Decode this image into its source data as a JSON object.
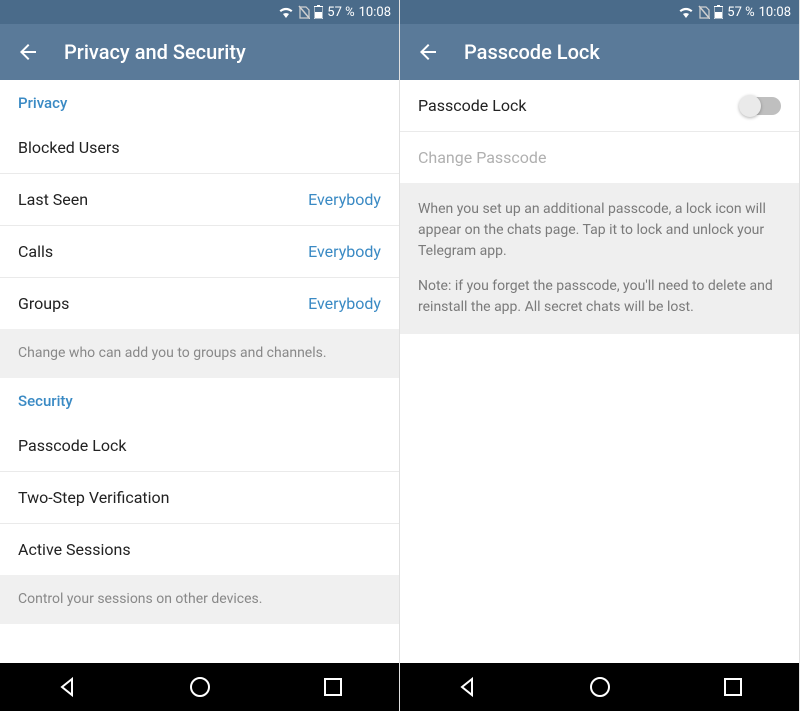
{
  "status": {
    "battery": "57 %",
    "time": "10:08"
  },
  "left": {
    "title": "Privacy and Security",
    "privacy_header": "Privacy",
    "blocked_users": "Blocked Users",
    "last_seen_label": "Last Seen",
    "last_seen_value": "Everybody",
    "calls_label": "Calls",
    "calls_value": "Everybody",
    "groups_label": "Groups",
    "groups_value": "Everybody",
    "groups_footer": "Change who can add you to groups and channels.",
    "security_header": "Security",
    "passcode_lock": "Passcode Lock",
    "two_step": "Two-Step Verification",
    "active_sessions": "Active Sessions",
    "sessions_footer": "Control your sessions on other devices."
  },
  "right": {
    "title": "Passcode Lock",
    "passcode_lock_label": "Passcode Lock",
    "change_passcode": "Change Passcode",
    "info_p1": "When you set up an additional passcode, a lock icon will appear on the chats page. Tap it to lock and unlock your Telegram app.",
    "info_p2": "Note: if you forget the passcode, you'll need to delete and reinstall the app. All secret chats will be lost."
  }
}
